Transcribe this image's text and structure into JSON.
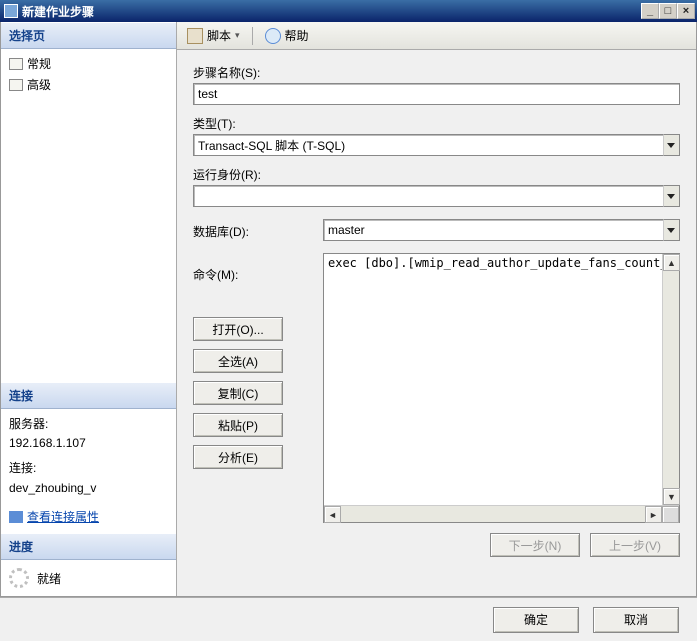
{
  "window": {
    "title": "新建作业步骤"
  },
  "winbtns": {
    "min": "_",
    "max": "□",
    "close": "×"
  },
  "sidebar": {
    "select_page_header": "选择页",
    "pages": [
      {
        "label": "常规"
      },
      {
        "label": "高级"
      }
    ],
    "connection_header": "连接",
    "server_label": "服务器:",
    "server_value": "192.168.1.107",
    "conn_label": "连接:",
    "conn_value": "dev_zhoubing_v",
    "view_props": "查看连接属性",
    "progress_header": "进度",
    "status": "就绪"
  },
  "toolbar": {
    "script": "脚本",
    "help": "帮助"
  },
  "form": {
    "step_name_label": "步骤名称(S):",
    "step_name_value": "test",
    "type_label": "类型(T):",
    "type_value": "Transact-SQL 脚本 (T-SQL)",
    "run_as_label": "运行身份(R):",
    "run_as_value": "",
    "database_label": "数据库(D):",
    "database_value": "master",
    "command_label": "命令(M):",
    "command_value": "exec [dbo].[wmip_read_author_update_fans_count_article_cou",
    "buttons": {
      "open": "打开(O)...",
      "select_all": "全选(A)",
      "copy": "复制(C)",
      "paste": "粘贴(P)",
      "parse": "分析(E)"
    },
    "nav": {
      "next": "下一步(N)",
      "prev": "上一步(V)"
    }
  },
  "footer": {
    "ok": "确定",
    "cancel": "取消"
  }
}
